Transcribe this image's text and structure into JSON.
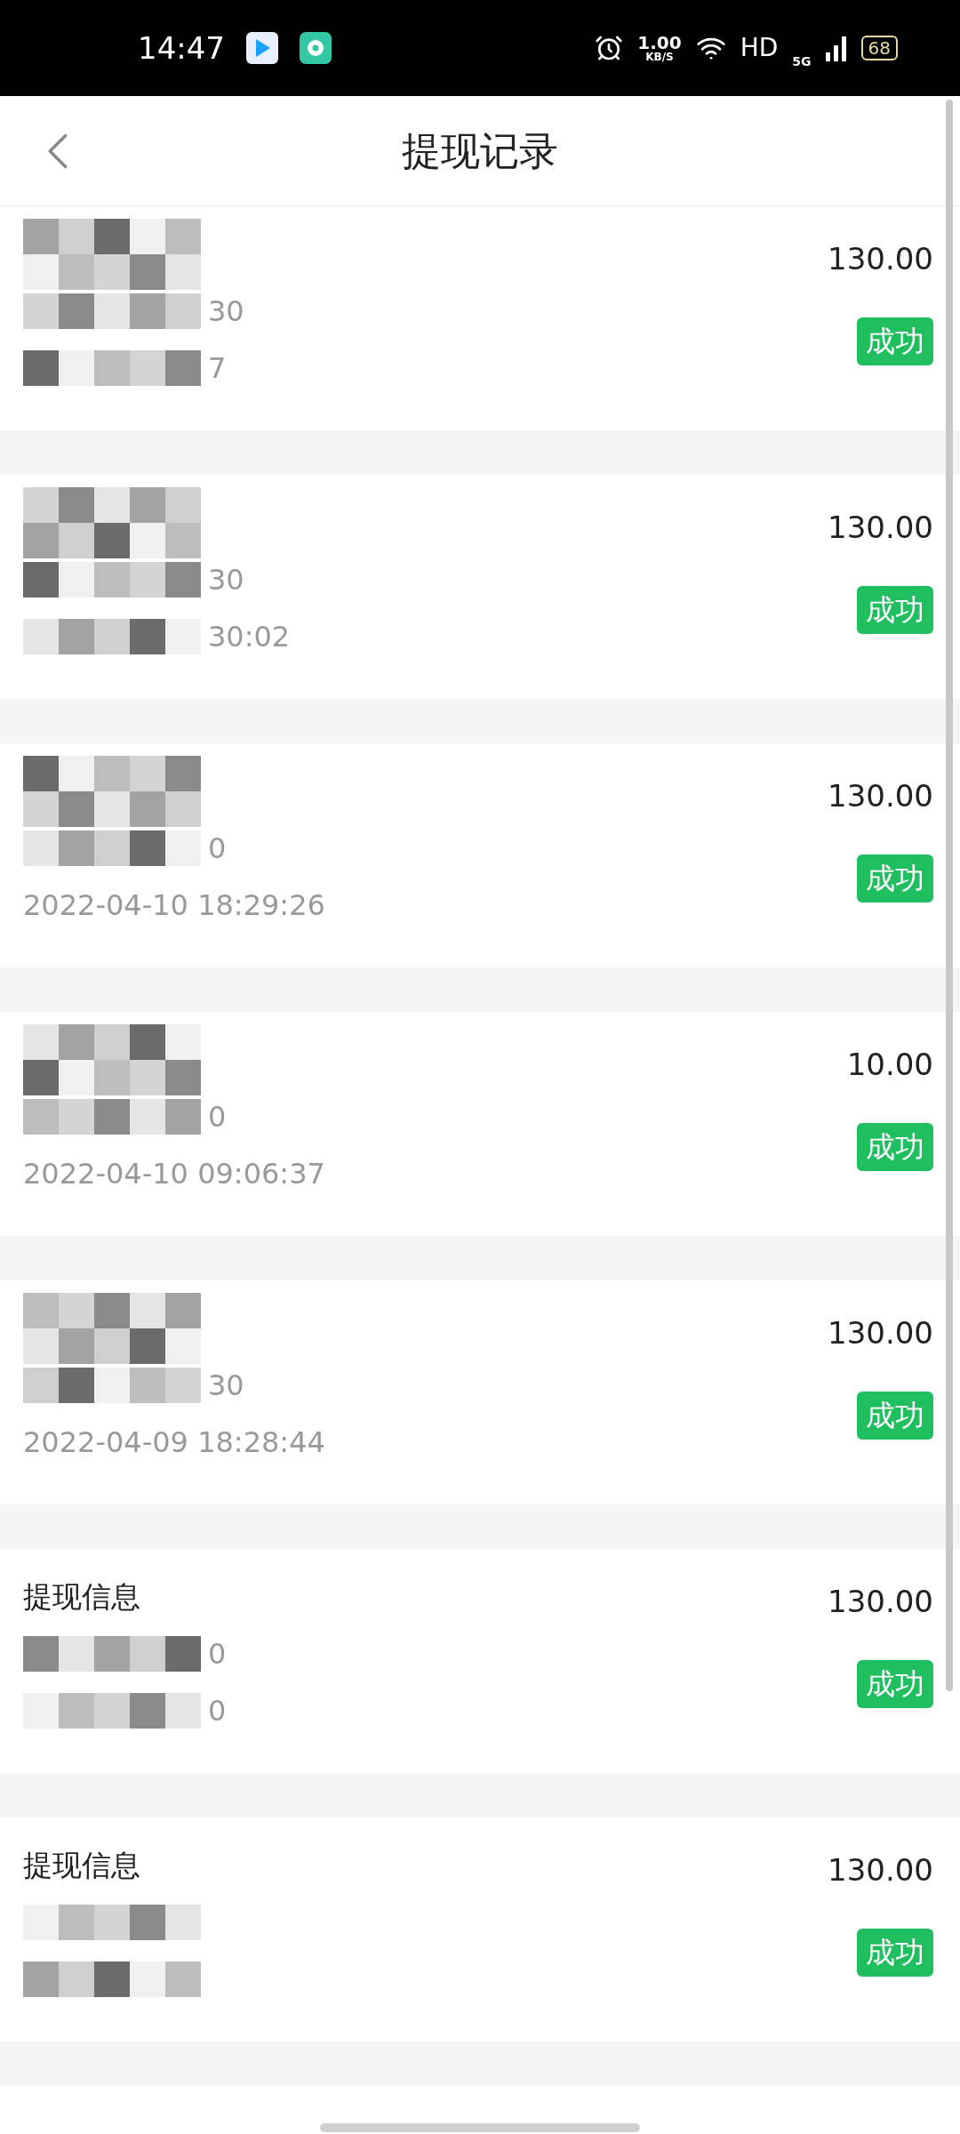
{
  "status_bar": {
    "time": "14:47",
    "speed": "1.00",
    "speed_unit": "KB/S",
    "hd": "HD",
    "network": "5G",
    "battery": "68"
  },
  "header": {
    "title": "提现记录"
  },
  "records": [
    {
      "title": {
        "masked": true
      },
      "account": {
        "masked": true,
        "text": "30"
      },
      "time": {
        "masked": true,
        "text": "7"
      },
      "amount": "130.00",
      "status": "成功"
    },
    {
      "title": {
        "masked": true
      },
      "account": {
        "masked": true,
        "text": "30"
      },
      "time": {
        "masked": true,
        "text": "30:02"
      },
      "amount": "130.00",
      "status": "成功"
    },
    {
      "title": {
        "masked": true
      },
      "account": {
        "masked": true,
        "text": "0"
      },
      "time": {
        "masked": false,
        "text": "2022-04-10 18:29:26"
      },
      "amount": "130.00",
      "status": "成功"
    },
    {
      "title": {
        "masked": true
      },
      "account": {
        "masked": true,
        "text": "0"
      },
      "time": {
        "masked": false,
        "text": "2022-04-10 09:06:37"
      },
      "amount": "10.00",
      "status": "成功"
    },
    {
      "title": {
        "masked": true
      },
      "account": {
        "masked": true,
        "text": "30"
      },
      "time": {
        "masked": false,
        "text": "2022-04-09 18:28:44"
      },
      "amount": "130.00",
      "status": "成功"
    },
    {
      "title": {
        "masked": false,
        "text": "提现信息"
      },
      "account": {
        "masked": true,
        "text": "0"
      },
      "time": {
        "masked": true,
        "text": "0"
      },
      "amount": "130.00",
      "status": "成功"
    },
    {
      "title": {
        "masked": false,
        "text": "提现信息"
      },
      "account": {
        "masked": true
      },
      "time": {
        "masked": true
      },
      "amount": "130.00",
      "status": "成功"
    }
  ]
}
